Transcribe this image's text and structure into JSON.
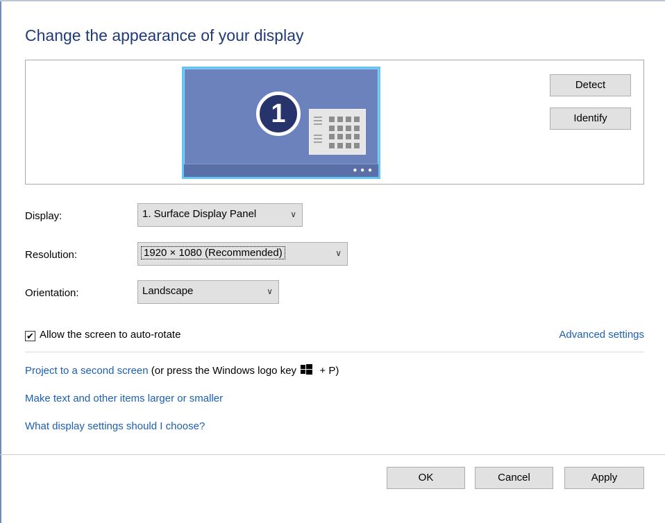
{
  "page": {
    "title": "Change the appearance of your display"
  },
  "preview": {
    "monitor_number": "1",
    "detect_label": "Detect",
    "identify_label": "Identify"
  },
  "settings": {
    "display_label": "Display:",
    "display_value": "1. Surface Display Panel",
    "resolution_label": "Resolution:",
    "resolution_value": "1920 × 1080 (Recommended)",
    "orientation_label": "Orientation:",
    "orientation_value": "Landscape",
    "autorotate_label": "Allow the screen to auto-rotate",
    "autorotate_checked": true,
    "advanced_link": "Advanced settings"
  },
  "links": {
    "project_link": "Project to a second screen",
    "project_hint_pre": "(or press the Windows logo key",
    "project_hint_post": "+ P)",
    "larger_link": "Make text and other items larger or smaller",
    "what_link": "What display settings should I choose?"
  },
  "footer": {
    "ok_label": "OK",
    "cancel_label": "Cancel",
    "apply_label": "Apply"
  },
  "colors": {
    "title": "#1e3a78",
    "link": "#1a5fb4",
    "monitor": "#6b82bd",
    "monitor_border": "#66c4f2"
  }
}
